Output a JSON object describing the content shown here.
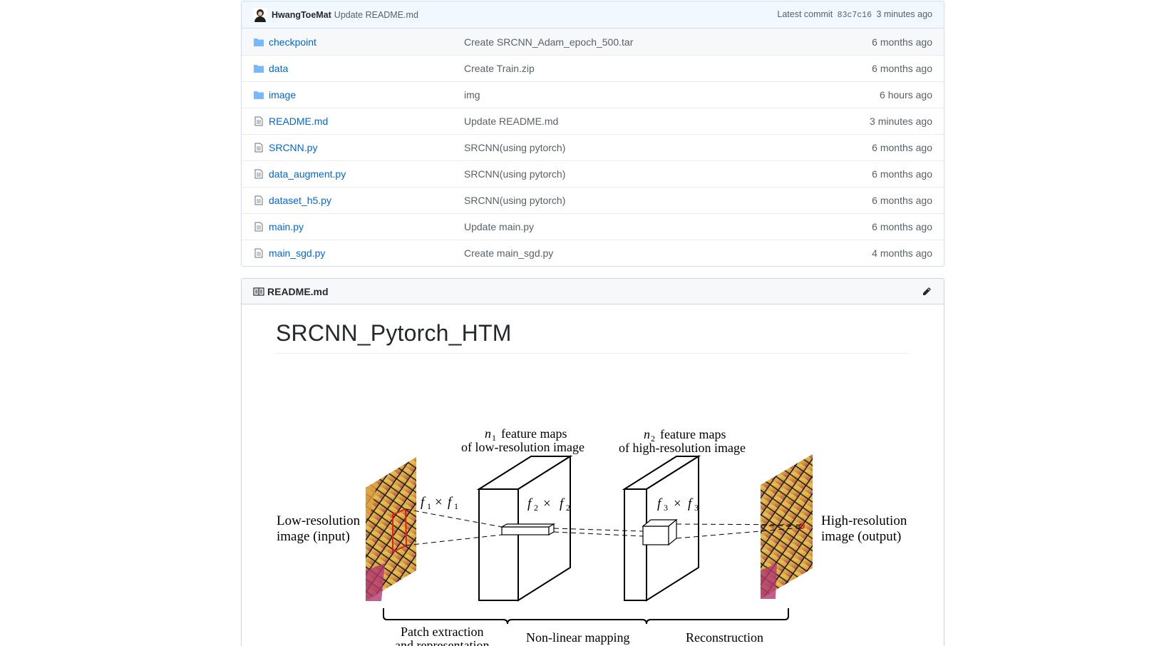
{
  "latest_commit": {
    "author": "HwangToeMat",
    "message": "Update README.md",
    "prefix": "Latest commit",
    "sha": "83c7c16",
    "age": "3 minutes ago"
  },
  "files": [
    {
      "type": "folder",
      "name": "checkpoint",
      "commit": "Create SRCNN_Adam_epoch_500.tar",
      "age": "6 months ago",
      "icon": "folder-icon"
    },
    {
      "type": "folder",
      "name": "data",
      "commit": "Create Train.zip",
      "age": "6 months ago",
      "icon": "folder-icon"
    },
    {
      "type": "folder",
      "name": "image",
      "commit": "img",
      "age": "6 hours ago",
      "icon": "folder-icon"
    },
    {
      "type": "file",
      "name": "README.md",
      "commit": "Update README.md",
      "age": "3 minutes ago",
      "icon": "file-icon"
    },
    {
      "type": "file",
      "name": "SRCNN.py",
      "commit": "SRCNN(using pytorch)",
      "age": "6 months ago",
      "icon": "file-icon"
    },
    {
      "type": "file",
      "name": "data_augment.py",
      "commit": "SRCNN(using pytorch)",
      "age": "6 months ago",
      "icon": "file-icon"
    },
    {
      "type": "file",
      "name": "dataset_h5.py",
      "commit": "SRCNN(using pytorch)",
      "age": "6 months ago",
      "icon": "file-icon"
    },
    {
      "type": "file",
      "name": "main.py",
      "commit": "Update main.py",
      "age": "6 months ago",
      "icon": "file-icon"
    },
    {
      "type": "file",
      "name": "main_sgd.py",
      "commit": "Create main_sgd.py",
      "age": "4 months ago",
      "icon": "file-icon"
    }
  ],
  "readme": {
    "filename": "README.md",
    "title": "SRCNN_Pytorch_HTM"
  },
  "diagram": {
    "input_label_1": "Low-resolution",
    "input_label_2": "image (input)",
    "output_label_1": "High-resolution",
    "output_label_2": "image (output)",
    "n1_label_1": "feature maps",
    "n1_label_2": "of low-resolution image",
    "n2_label_1": "feature maps",
    "n2_label_2": "of high-resolution image",
    "f1": "× ",
    "stage_1_line_1": "Patch extraction",
    "stage_1_line_2": "and representation",
    "stage_2": "Non-linear mapping",
    "stage_3": "Reconstruction"
  },
  "colors": {
    "link": "#0366d6",
    "muted": "#586069",
    "commit_bar_bg": "#f1f8ff",
    "folder_icon": "#79b8ff",
    "patch_red": "#e0201b"
  }
}
